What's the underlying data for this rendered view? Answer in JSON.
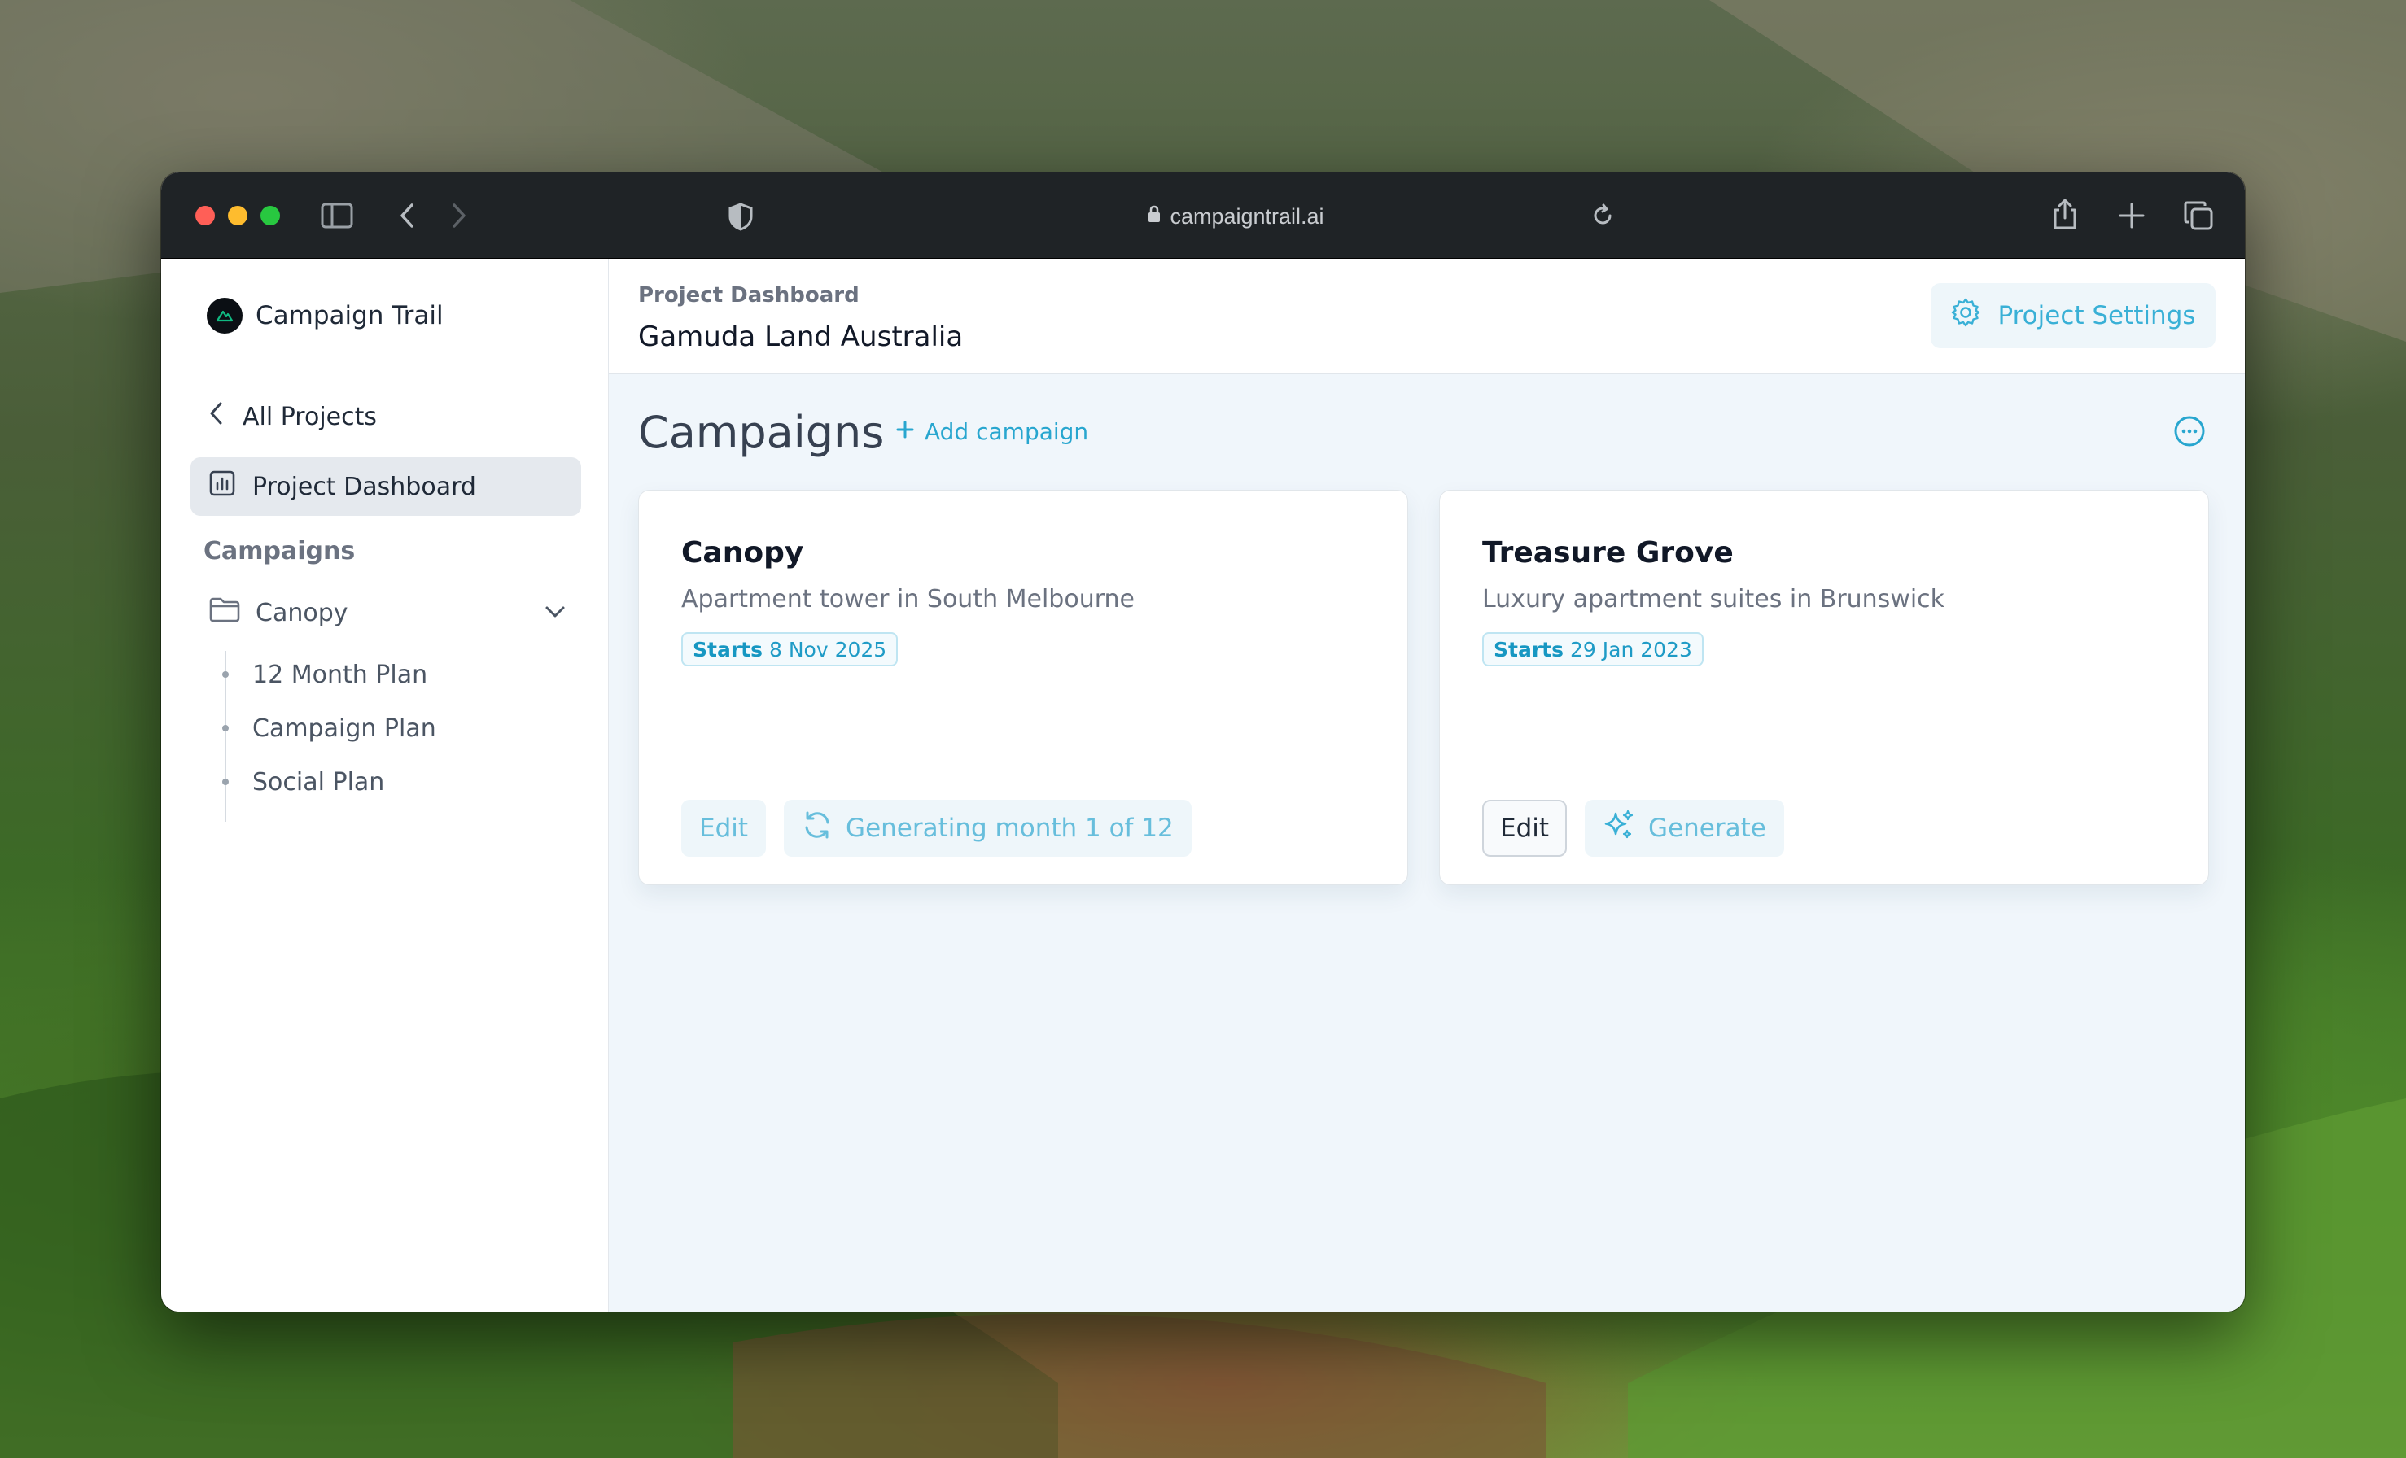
{
  "browser": {
    "url": "campaigntrail.ai",
    "traffic_lights": {
      "close": "#ff5f57",
      "minimize": "#febc2e",
      "maximize": "#28c840"
    },
    "icons": [
      "sidebar-toggle-icon",
      "back-icon",
      "forward-icon",
      "shield-icon",
      "lock-icon",
      "reload-icon",
      "share-icon",
      "new-tab-icon",
      "tabs-overview-icon"
    ]
  },
  "sidebar": {
    "brand": "Campaign Trail",
    "back_label": "All Projects",
    "active_item": "Project Dashboard",
    "section_title": "Campaigns",
    "folder": "Canopy",
    "subitems": [
      "12 Month Plan",
      "Campaign Plan",
      "Social Plan"
    ]
  },
  "header": {
    "breadcrumb": "Project Dashboard",
    "project_title": "Gamuda Land Australia",
    "settings_label": "Project Settings"
  },
  "main": {
    "section_title": "Campaigns",
    "add_label": "Add campaign",
    "accent": "#28a6cf",
    "cards": [
      {
        "title": "Canopy",
        "description": "Apartment tower in South Melbourne",
        "badge_label": "Starts",
        "badge_date": "8 Nov 2025",
        "edit_label": "Edit",
        "action_label": "Generating month 1 of 12"
      },
      {
        "title": "Treasure Grove",
        "description": "Luxury apartment suites in Brunswick",
        "badge_label": "Starts",
        "badge_date": "29 Jan 2023",
        "edit_label": "Edit",
        "action_label": "Generate"
      }
    ]
  }
}
